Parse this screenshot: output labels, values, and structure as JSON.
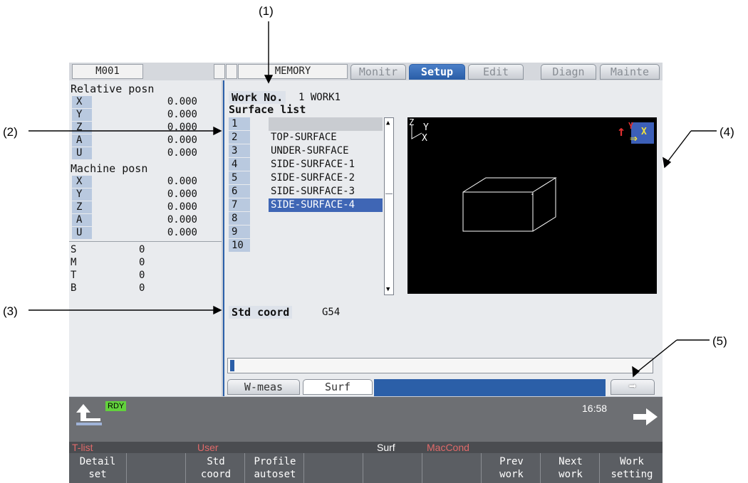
{
  "callouts": [
    "(1)",
    "(2)",
    "(3)",
    "(4)",
    "(5)"
  ],
  "topbar": {
    "program": "M001",
    "mode": "MEMORY",
    "tabs": [
      {
        "label": "Monitr",
        "active": false
      },
      {
        "label": "Setup",
        "active": true
      },
      {
        "label": "Edit",
        "active": false
      },
      {
        "label": "Diagn",
        "active": false
      },
      {
        "label": "Mainte",
        "active": false
      }
    ]
  },
  "left": {
    "relative_title": "Relative posn",
    "relative": [
      {
        "axis": "X",
        "value": "0.000"
      },
      {
        "axis": "Y",
        "value": "0.000"
      },
      {
        "axis": "Z",
        "value": "0.000"
      },
      {
        "axis": "A",
        "value": "0.000"
      },
      {
        "axis": "U",
        "value": "0.000"
      }
    ],
    "machine_title": "Machine posn",
    "machine": [
      {
        "axis": "X",
        "value": "0.000"
      },
      {
        "axis": "Y",
        "value": "0.000"
      },
      {
        "axis": "Z",
        "value": "0.000"
      },
      {
        "axis": "A",
        "value": "0.000"
      },
      {
        "axis": "U",
        "value": "0.000"
      }
    ],
    "smtb": [
      {
        "label": "S",
        "value": "0"
      },
      {
        "label": "M",
        "value": "0"
      },
      {
        "label": "T",
        "value": "0"
      },
      {
        "label": "B",
        "value": "0"
      }
    ]
  },
  "main": {
    "work_label": "Work No.",
    "work_value": "1 WORK1",
    "surface_title": "Surface list",
    "surfaces": [
      {
        "no": "1",
        "name": ""
      },
      {
        "no": "2",
        "name": "TOP-SURFACE"
      },
      {
        "no": "3",
        "name": "UNDER-SURFACE"
      },
      {
        "no": "4",
        "name": "SIDE-SURFACE-1"
      },
      {
        "no": "5",
        "name": "SIDE-SURFACE-2"
      },
      {
        "no": "6",
        "name": "SIDE-SURFACE-3"
      },
      {
        "no": "7",
        "name": "SIDE-SURFACE-4"
      },
      {
        "no": "8",
        "name": ""
      },
      {
        "no": "9",
        "name": ""
      },
      {
        "no": "10",
        "name": ""
      }
    ],
    "selected_surface": "7",
    "std_label": "Std coord",
    "std_value": "G54",
    "view_axes": {
      "z": "Z",
      "y": "Y",
      "x": "X"
    },
    "view_icon_axes": {
      "y": "Y",
      "x": "X"
    },
    "subtabs": [
      "W-meas",
      "Surf"
    ]
  },
  "status": {
    "rdy": "RDY",
    "time": "16:58"
  },
  "menu_labels": [
    {
      "label": "T-list",
      "color": "#e06a6a"
    },
    {
      "label": "User",
      "color": "#e06a6a"
    },
    {
      "label": "Surf",
      "color": "#ffffff"
    },
    {
      "label": "MacCond",
      "color": "#e06a6a"
    }
  ],
  "softkeys": [
    [
      "Detail",
      "set"
    ],
    [
      "",
      ""
    ],
    [
      "Std",
      "coord"
    ],
    [
      "Profile",
      "autoset"
    ],
    [
      "",
      ""
    ],
    [
      "",
      ""
    ],
    [
      "",
      ""
    ],
    [
      "Prev",
      "work"
    ],
    [
      "Next",
      "work"
    ],
    [
      "Work",
      "setting"
    ]
  ],
  "colors": {
    "accent": "#2b5fa8",
    "selected": "#3f66b5",
    "rdy": "#62d23c"
  }
}
